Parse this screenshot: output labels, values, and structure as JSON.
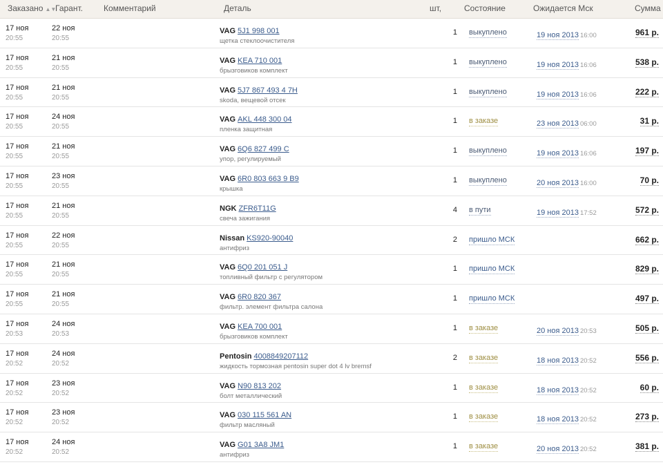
{
  "headers": {
    "ordered": "Заказано",
    "guarantee": "Гарант.",
    "comment": "Комментарий",
    "part": "Деталь",
    "qty": "шт,",
    "status": "Состояние",
    "expected": "Ожидается Мск",
    "sum": "Сумма"
  },
  "colors": {
    "header_bg": "#f4f1ec",
    "link": "#3a5b8c",
    "status_order": "#9e8e42"
  },
  "rows": [
    {
      "ordered_date": "17 ноя",
      "ordered_time": "20:55",
      "guarantee_date": "22 ноя",
      "guarantee_time": "20:55",
      "brand": "VAG",
      "code": "5J1 998 001",
      "description": "щетка стеклоочистителя",
      "qty": "1",
      "status": "выкуплено",
      "status_kind": "bought",
      "eta_date": "19 ноя 2013",
      "eta_time": "16:00",
      "sum": "961 р."
    },
    {
      "ordered_date": "17 ноя",
      "ordered_time": "20:55",
      "guarantee_date": "21 ноя",
      "guarantee_time": "20:55",
      "brand": "VAG",
      "code": "KEA 710 001",
      "description": "брызговиков комплект",
      "qty": "1",
      "status": "выкуплено",
      "status_kind": "bought",
      "eta_date": "19 ноя 2013",
      "eta_time": "16:06",
      "sum": "538 р."
    },
    {
      "ordered_date": "17 ноя",
      "ordered_time": "20:55",
      "guarantee_date": "21 ноя",
      "guarantee_time": "20:55",
      "brand": "VAG",
      "code": "5J7 867 493 4 7H",
      "description": "skoda, вещевой отсек",
      "qty": "1",
      "status": "выкуплено",
      "status_kind": "bought",
      "eta_date": "19 ноя 2013",
      "eta_time": "16:06",
      "sum": "222 р."
    },
    {
      "ordered_date": "17 ноя",
      "ordered_time": "20:55",
      "guarantee_date": "24 ноя",
      "guarantee_time": "20:55",
      "brand": "VAG",
      "code": "AKL 448 300 04",
      "description": "пленка защитная",
      "qty": "1",
      "status": "в заказе",
      "status_kind": "order",
      "eta_date": "23 ноя 2013",
      "eta_time": "06:00",
      "sum": "31 р."
    },
    {
      "ordered_date": "17 ноя",
      "ordered_time": "20:55",
      "guarantee_date": "21 ноя",
      "guarantee_time": "20:55",
      "brand": "VAG",
      "code": "6Q6 827 499 C",
      "description": "упор, регулируемый",
      "qty": "1",
      "status": "выкуплено",
      "status_kind": "bought",
      "eta_date": "19 ноя 2013",
      "eta_time": "16:06",
      "sum": "197 р."
    },
    {
      "ordered_date": "17 ноя",
      "ordered_time": "20:55",
      "guarantee_date": "23 ноя",
      "guarantee_time": "20:55",
      "brand": "VAG",
      "code": "6R0 803 663 9 B9",
      "description": "крышка",
      "qty": "1",
      "status": "выкуплено",
      "status_kind": "bought",
      "eta_date": "20 ноя 2013",
      "eta_time": "16:00",
      "sum": "70 р."
    },
    {
      "ordered_date": "17 ноя",
      "ordered_time": "20:55",
      "guarantee_date": "21 ноя",
      "guarantee_time": "20:55",
      "brand": "NGK",
      "code": "ZFR6T11G",
      "description": "свеча зажигания",
      "qty": "4",
      "status": "в пути",
      "status_kind": "way",
      "eta_date": "19 ноя 2013",
      "eta_time": "17:52",
      "sum": "572 р."
    },
    {
      "ordered_date": "17 ноя",
      "ordered_time": "20:55",
      "guarantee_date": "22 ноя",
      "guarantee_time": "20:55",
      "brand": "Nissan",
      "code": "KS920-90040",
      "description": "антифриз",
      "qty": "2",
      "status": "пришло МСК",
      "status_kind": "arrived",
      "eta_date": "",
      "eta_time": "",
      "sum": "662 р."
    },
    {
      "ordered_date": "17 ноя",
      "ordered_time": "20:55",
      "guarantee_date": "21 ноя",
      "guarantee_time": "20:55",
      "brand": "VAG",
      "code": "6Q0 201 051 J",
      "description": "топливный фильтр с регулятором",
      "qty": "1",
      "status": "пришло МСК",
      "status_kind": "arrived",
      "eta_date": "",
      "eta_time": "",
      "sum": "829 р."
    },
    {
      "ordered_date": "17 ноя",
      "ordered_time": "20:55",
      "guarantee_date": "21 ноя",
      "guarantee_time": "20:55",
      "brand": "VAG",
      "code": "6R0 820 367",
      "description": "фильтр. элемент фильтра салона",
      "qty": "1",
      "status": "пришло МСК",
      "status_kind": "arrived",
      "eta_date": "",
      "eta_time": "",
      "sum": "497 р."
    },
    {
      "ordered_date": "17 ноя",
      "ordered_time": "20:53",
      "guarantee_date": "24 ноя",
      "guarantee_time": "20:53",
      "brand": "VAG",
      "code": "KEA 700 001",
      "description": "брызговиков комплект",
      "qty": "1",
      "status": "в заказе",
      "status_kind": "order",
      "eta_date": "20 ноя 2013",
      "eta_time": "20:53",
      "sum": "505 р."
    },
    {
      "ordered_date": "17 ноя",
      "ordered_time": "20:52",
      "guarantee_date": "24 ноя",
      "guarantee_time": "20:52",
      "brand": "Pentosin",
      "code": "4008849207112",
      "description": "жидкость тормозная pentosin super dot 4 lv bremsf",
      "qty": "2",
      "status": "в заказе",
      "status_kind": "order",
      "eta_date": "18 ноя 2013",
      "eta_time": "20:52",
      "sum": "556 р."
    },
    {
      "ordered_date": "17 ноя",
      "ordered_time": "20:52",
      "guarantee_date": "23 ноя",
      "guarantee_time": "20:52",
      "brand": "VAG",
      "code": "N90 813 202",
      "description": "болт металлический",
      "qty": "1",
      "status": "в заказе",
      "status_kind": "order",
      "eta_date": "18 ноя 2013",
      "eta_time": "20:52",
      "sum": "60 р."
    },
    {
      "ordered_date": "17 ноя",
      "ordered_time": "20:52",
      "guarantee_date": "23 ноя",
      "guarantee_time": "20:52",
      "brand": "VAG",
      "code": "030 115 561 AN",
      "description": "фильтр масляный",
      "qty": "1",
      "status": "в заказе",
      "status_kind": "order",
      "eta_date": "18 ноя 2013",
      "eta_time": "20:52",
      "sum": "273 р."
    },
    {
      "ordered_date": "17 ноя",
      "ordered_time": "20:52",
      "guarantee_date": "24 ноя",
      "guarantee_time": "20:52",
      "brand": "VAG",
      "code": "G01 3A8 JM1",
      "description": "антифриз",
      "qty": "1",
      "status": "в заказе",
      "status_kind": "order",
      "eta_date": "20 ноя 2013",
      "eta_time": "20:52",
      "sum": "381 р."
    }
  ]
}
